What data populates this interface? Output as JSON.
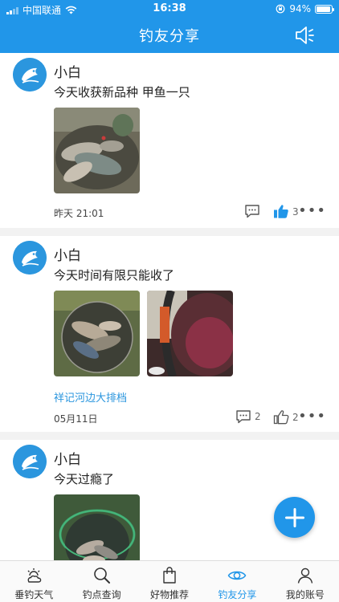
{
  "status_bar": {
    "carrier": "中国联通",
    "time": "16:38",
    "battery": "94%",
    "battery_level": 0.94
  },
  "header": {
    "title": "钓友分享",
    "right_icon": "speaker-icon"
  },
  "posts": [
    {
      "user": "小白",
      "text": "今天收获新品种 甲鱼一只",
      "time": "昨天 21:01",
      "comments": "",
      "likes": "3",
      "liked": true,
      "link": ""
    },
    {
      "user": "小白",
      "text": "今天时间有限只能收了",
      "time": "05月11日",
      "comments": "2",
      "likes": "2",
      "liked": false,
      "link": "祥记河边大排档"
    },
    {
      "user": "小白",
      "text": "今天过瘾了"
    }
  ],
  "more_label": "•••",
  "tabs": [
    {
      "label": "垂钓天气",
      "icon": "weather-icon"
    },
    {
      "label": "钓点查询",
      "icon": "search-icon"
    },
    {
      "label": "好物推荐",
      "icon": "bag-icon"
    },
    {
      "label": "钓友分享",
      "icon": "eye-icon",
      "active": true
    },
    {
      "label": "我的账号",
      "icon": "person-icon"
    }
  ],
  "colors": {
    "primary": "#2196e9",
    "link": "#2b96de",
    "tab_inactive": "#333333"
  }
}
